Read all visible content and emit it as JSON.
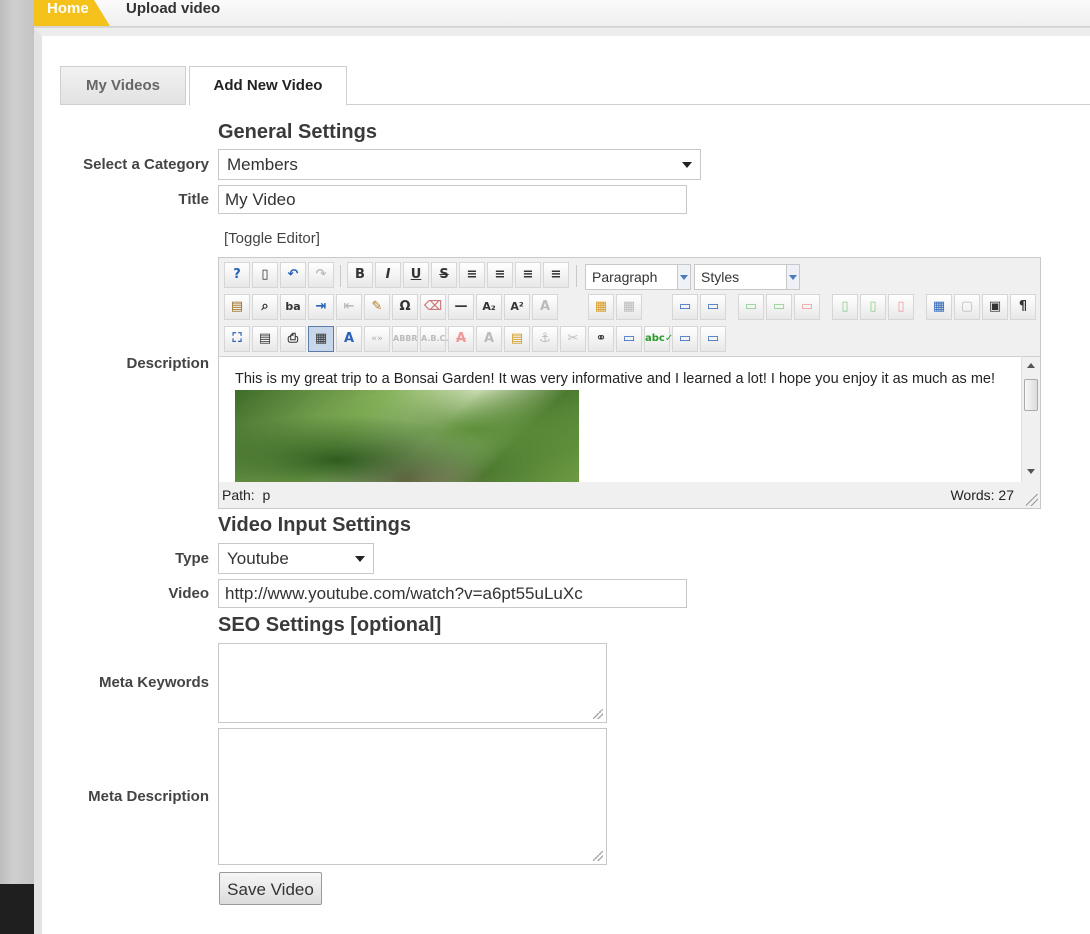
{
  "breadcrumb": {
    "home": "Home",
    "current": "Upload video"
  },
  "tabs": [
    {
      "label": "My Videos",
      "active": false
    },
    {
      "label": "Add New Video",
      "active": true
    }
  ],
  "general": {
    "heading": "General Settings",
    "category_label": "Select a Category",
    "category_value": "Members",
    "title_label": "Title",
    "title_value": "My Video",
    "toggle_editor": "[Toggle Editor]",
    "description_label": "Description"
  },
  "editor": {
    "format_dropdown": "Paragraph",
    "styles_dropdown": "Styles",
    "content_text": "This is my great trip to a Bonsai Garden! It was very informative and I learned a lot! I hope you enjoy it as much as me!",
    "path_label": "Path:",
    "path_value": "p",
    "word_count": "Words: 27"
  },
  "video": {
    "heading": "Video Input Settings",
    "type_label": "Type",
    "type_value": "Youtube",
    "video_label": "Video",
    "video_value": "http://www.youtube.com/watch?v=a6pt55uLuXc"
  },
  "seo": {
    "heading": "SEO Settings [optional]",
    "keywords_label": "Meta Keywords",
    "description_label": "Meta Description"
  },
  "save_button": "Save Video",
  "colors": {
    "accent": "#f5c21b",
    "panel": "#ffffff",
    "border": "#c8c8c8"
  }
}
